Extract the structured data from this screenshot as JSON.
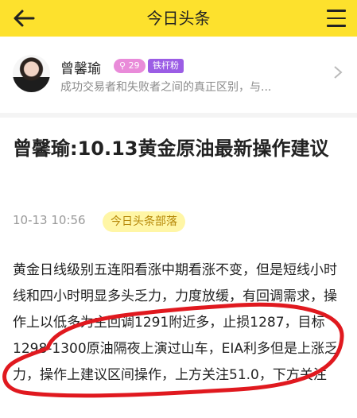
{
  "header": {
    "title": "今日头条"
  },
  "author": {
    "name": "曾馨瑜",
    "level_badge": "29",
    "fan_badge": "铁杆粉",
    "subtitle": "成功交易者和失败者之间的真正区别，与..."
  },
  "article": {
    "title": "曾馨瑜:10.13黄金原油最新操作建议",
    "timestamp": "10-13 10:56",
    "source_tag": "今日头条部落",
    "body": "黄金日线级别五连阳看涨中期看涨不变，但是短线小时线和四小时明显多头乏力，力度放缓，有回调需求，操作上以低多为主回调1291附近多，止损1287，目标1298-1300原油隔夜上演过山车，EIA利多但是上涨乏力，操作上建议区间操作，上方关注51.0，下方关注"
  },
  "colors": {
    "header_bg": "#fde12d",
    "level_badge": "#e98bd9",
    "fan_badge": "#9b5de5",
    "tag_bg": "#fff6a6",
    "annotation": "#e0191f"
  }
}
